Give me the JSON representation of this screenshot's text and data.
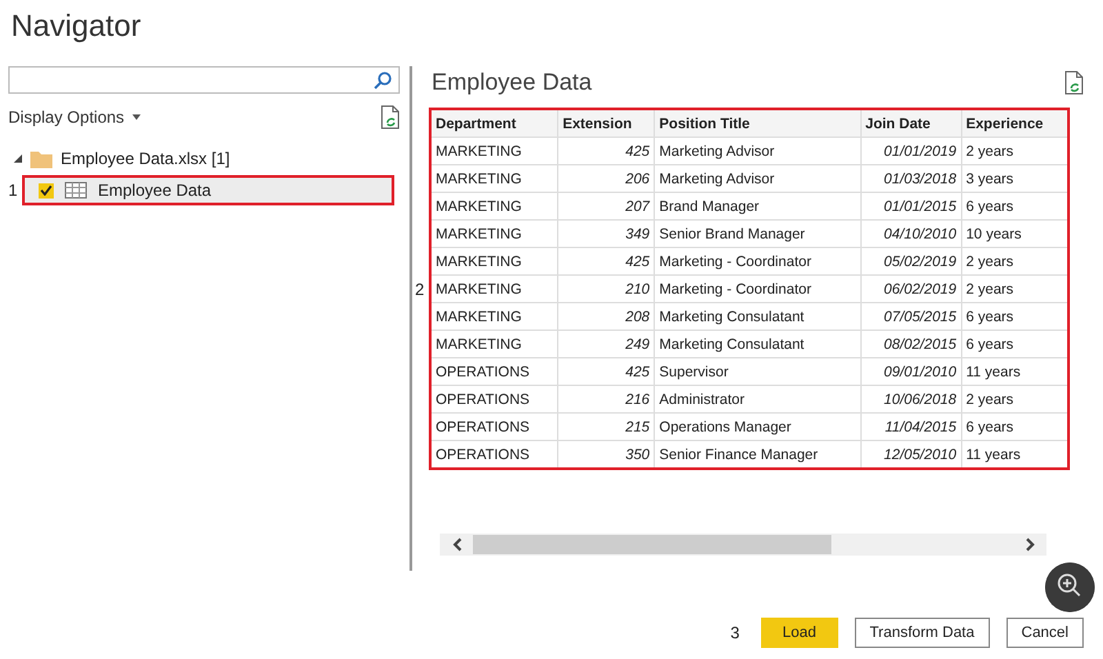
{
  "window": {
    "title": "Navigator"
  },
  "left": {
    "display_options": "Display Options",
    "tree": [
      {
        "label": "Employee Data.xlsx [1]",
        "expanded": true,
        "children": [
          {
            "label": "Employee Data",
            "checked": true,
            "selected": true,
            "annotation": "1"
          }
        ]
      }
    ]
  },
  "preview": {
    "title": "Employee Data",
    "annotation": "2",
    "columns": [
      "Department",
      "Extension",
      "Position Title",
      "Join Date",
      "Experience"
    ],
    "rows": [
      [
        "MARKETING",
        "425",
        "Marketing Advisor",
        "01/01/2019",
        "2 years"
      ],
      [
        "MARKETING",
        "206",
        "Marketing Advisor",
        "01/03/2018",
        "3 years"
      ],
      [
        "MARKETING",
        "207",
        "Brand Manager",
        "01/01/2015",
        "6 years"
      ],
      [
        "MARKETING",
        "349",
        "Senior Brand Manager",
        "04/10/2010",
        "10 years"
      ],
      [
        "MARKETING",
        "425",
        "Marketing - Coordinator",
        "05/02/2019",
        "2 years"
      ],
      [
        "MARKETING",
        "210",
        "Marketing - Coordinator",
        "06/02/2019",
        "2 years"
      ],
      [
        "MARKETING",
        "208",
        "Marketing Consulatant",
        "07/05/2015",
        "6 years"
      ],
      [
        "MARKETING",
        "249",
        "Marketing Consulatant",
        "08/02/2015",
        "6 years"
      ],
      [
        "OPERATIONS",
        "425",
        "Supervisor",
        "09/01/2010",
        "11 years"
      ],
      [
        "OPERATIONS",
        "216",
        "Administrator",
        "10/06/2018",
        "2 years"
      ],
      [
        "OPERATIONS",
        "215",
        "Operations Manager",
        "11/04/2015",
        "6 years"
      ],
      [
        "OPERATIONS",
        "350",
        "Senior Finance Manager",
        "12/05/2010",
        "11 years"
      ]
    ]
  },
  "footer": {
    "annotation": "3",
    "buttons": [
      {
        "label": "Load",
        "kind": "primary"
      },
      {
        "label": "Transform Data",
        "kind": "normal"
      },
      {
        "label": "Cancel",
        "kind": "normal"
      }
    ]
  }
}
